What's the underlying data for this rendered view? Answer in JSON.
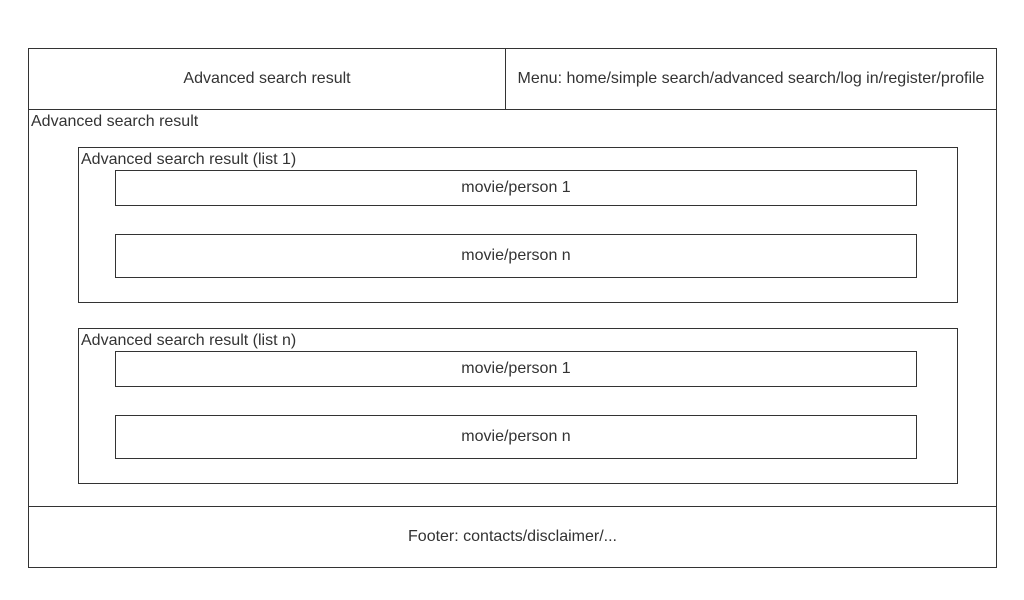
{
  "header": {
    "title": "Advanced search result",
    "menu": "Menu: home/simple search/advanced search/log in/register/profile"
  },
  "content": {
    "label": "Advanced search result",
    "lists": [
      {
        "label": "Advanced search result (list 1)",
        "items": [
          "movie/person 1",
          "movie/person n"
        ]
      },
      {
        "label": "Advanced search result (list n)",
        "items": [
          "movie/person 1",
          "movie/person n"
        ]
      }
    ]
  },
  "footer": {
    "text": "Footer: contacts/disclaimer/..."
  }
}
